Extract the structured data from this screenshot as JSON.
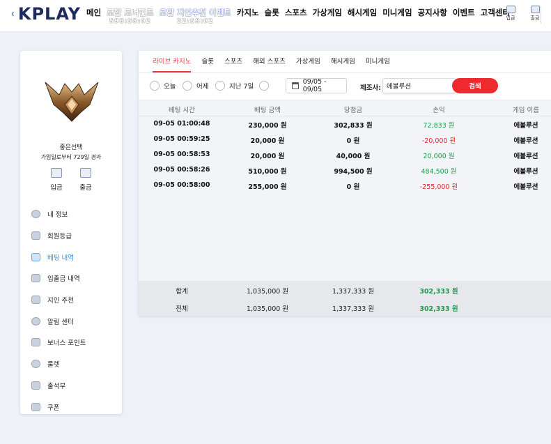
{
  "header": {
    "logo_text": "KPLAY",
    "nav": [
      {
        "label": "메인",
        "style": "normal",
        "sub": ""
      },
      {
        "label": "로얄 토너먼트",
        "style": "ghost",
        "sub": "598:58:02"
      },
      {
        "label": "로얄 지인추천 이벤트",
        "style": "ghost2",
        "sub": "22:58:02"
      },
      {
        "label": "카지노",
        "style": "normal",
        "sub": ""
      },
      {
        "label": "슬롯",
        "style": "normal",
        "sub": ""
      },
      {
        "label": "스포츠",
        "style": "normal",
        "sub": ""
      },
      {
        "label": "가상게임",
        "style": "normal",
        "sub": ""
      },
      {
        "label": "해시게임",
        "style": "normal",
        "sub": ""
      },
      {
        "label": "미니게임",
        "style": "normal",
        "sub": ""
      },
      {
        "label": "공지사항",
        "style": "normal",
        "sub": ""
      },
      {
        "label": "이벤트",
        "style": "normal",
        "sub": ""
      },
      {
        "label": "고객센터",
        "style": "normal",
        "sub": ""
      }
    ],
    "deposit_label": "입금",
    "withdraw_label": "출금"
  },
  "sidebar": {
    "user_name": "좋은선택",
    "since_text": "가입일로부터 729일 경과",
    "deposit_label": "입금",
    "withdraw_label": "출금",
    "menu": [
      {
        "label": "내 정보",
        "icon": "user-icon",
        "active": false
      },
      {
        "label": "회원등급",
        "icon": "badge-icon",
        "active": false
      },
      {
        "label": "베팅 내역",
        "icon": "ticket-icon",
        "active": true
      },
      {
        "label": "입출금 내역",
        "icon": "wallet-icon",
        "active": false
      },
      {
        "label": "지인 추천",
        "icon": "heart-icon",
        "active": false
      },
      {
        "label": "알림 센터",
        "icon": "chat-icon",
        "active": false
      },
      {
        "label": "보너스 포인트",
        "icon": "coin-icon",
        "active": false
      },
      {
        "label": "룰렛",
        "icon": "roulette-icon",
        "active": false
      },
      {
        "label": "출석부",
        "icon": "calendar-icon",
        "active": false
      },
      {
        "label": "쿠폰",
        "icon": "coupon-icon",
        "active": false
      }
    ]
  },
  "tabs": [
    {
      "label": "라이브 카지노",
      "active": true
    },
    {
      "label": "슬롯",
      "active": false
    },
    {
      "label": "스포츠",
      "active": false
    },
    {
      "label": "해외 스포츠",
      "active": false
    },
    {
      "label": "가상게임",
      "active": false
    },
    {
      "label": "해시게임",
      "active": false
    },
    {
      "label": "미니게임",
      "active": false
    }
  ],
  "filters": {
    "today": "오늘",
    "yesterday": "어제",
    "last7": "지난 7일",
    "date_range": "09/05 - 09/05",
    "maker_label": "제조사:",
    "maker_value": "에볼루션",
    "search_label": "검색"
  },
  "table": {
    "headers": [
      "베팅 시간",
      "베팅 금액",
      "당첨금",
      "손익",
      "게임 이름"
    ],
    "rows": [
      {
        "time": "09-05 01:00:48",
        "bet": "230,000 원",
        "win": "302,833 원",
        "pl": "72,833 원",
        "pl_sign": "pos",
        "game": "에볼루션"
      },
      {
        "time": "09-05 00:59:25",
        "bet": "20,000 원",
        "win": "0 원",
        "pl": "-20,000 원",
        "pl_sign": "neg",
        "game": "에볼루션"
      },
      {
        "time": "09-05 00:58:53",
        "bet": "20,000 원",
        "win": "40,000 원",
        "pl": "20,000 원",
        "pl_sign": "pos",
        "game": "에볼루션"
      },
      {
        "time": "09-05 00:58:26",
        "bet": "510,000 원",
        "win": "994,500 원",
        "pl": "484,500 원",
        "pl_sign": "pos",
        "game": "에볼루션"
      },
      {
        "time": "09-05 00:58:00",
        "bet": "255,000 원",
        "win": "0 원",
        "pl": "-255,000 원",
        "pl_sign": "neg",
        "game": "에볼루션"
      }
    ],
    "summary": [
      {
        "label": "합계",
        "bet": "1,035,000 원",
        "win": "1,337,333 원",
        "pl": "302,333 원"
      },
      {
        "label": "전체",
        "bet": "1,035,000 원",
        "win": "1,337,333 원",
        "pl": "302,333 원"
      }
    ]
  }
}
